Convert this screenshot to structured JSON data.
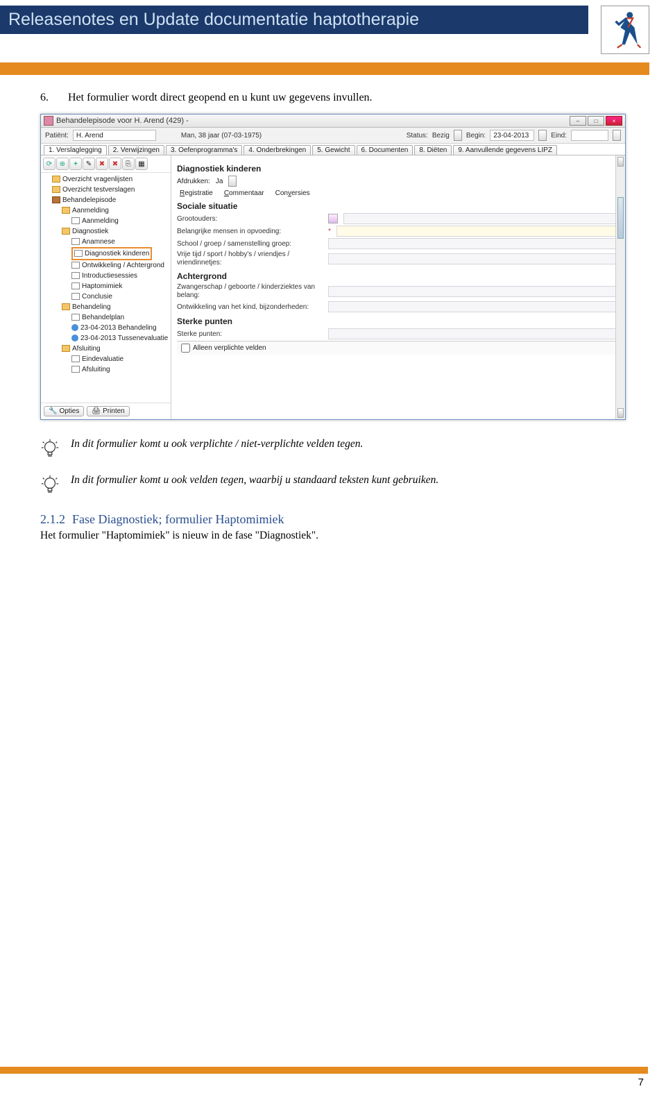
{
  "doc": {
    "title": "Releasenotes en Update documentatie haptotherapie",
    "step_num": "6.",
    "step_text": "Het formulier wordt direct geopend en u kunt uw gegevens invullen.",
    "tip1": "In dit formulier komt u ook verplichte / niet-verplichte velden tegen.",
    "tip2": "In dit formulier komt u ook velden tegen, waarbij u standaard teksten kunt gebruiken.",
    "h2_num": "2.1.2",
    "h2_text": "Fase Diagnostiek; formulier Haptomimiek",
    "h2_para": "Het formulier \"Haptomimiek\" is nieuw in de fase \"Diagnostiek\".",
    "page_number": "7"
  },
  "win": {
    "title": "Behandelepisode voor H. Arend (429) -",
    "patient_label": "Patiënt:",
    "patient_value": "H. Arend",
    "patient_info": "Man, 38 jaar (07-03-1975)",
    "status_label": "Status:",
    "status_value": "Bezig",
    "begin_label": "Begin:",
    "begin_value": "23-04-2013",
    "eind_label": "Eind:",
    "tabs": [
      "1. Verslaglegging",
      "2. Verwijzingen",
      "3. Oefenprogramma's",
      "4. Onderbrekingen",
      "5. Gewicht",
      "6. Documenten",
      "8. Diëten",
      "9. Aanvullende gegevens LIPZ"
    ],
    "tree": {
      "n1": "Overzicht vragenlijsten",
      "n2": "Overzicht testverslagen",
      "n3": "Behandelepisode",
      "n4": "Aanmelding",
      "n5": "Aanmelding",
      "n6": "Diagnostiek",
      "n7": "Anamnese",
      "n8": "Diagnostiek kinderen",
      "n9": "Ontwikkeling / Achtergrond",
      "n10": "Introductiesessies",
      "n11": "Haptomimiek",
      "n12": "Conclusie",
      "n13": "Behandeling",
      "n14": "Behandelplan",
      "n15": "23-04-2013 Behandeling",
      "n16": "23-04-2013 Tussenevaluatie",
      "n17": "Afsluiting",
      "n18": "Eindevaluatie",
      "n19": "Afsluiting"
    },
    "opties_btn": "Opties",
    "print_btn": "Printen",
    "form": {
      "header": "Diagnostiek kinderen",
      "afdrukken_label": "Afdrukken:",
      "afdrukken_value": "Ja",
      "subtabs": [
        "Registratie",
        "Commentaar",
        "Conversies"
      ],
      "sec1": "Sociale situatie",
      "f1": "Grootouders:",
      "f2": "Belangrijke mensen in opvoeding:",
      "f3": "School / groep / samenstelling groep:",
      "f4": "Vrije tijd / sport / hobby's / vriendjes / vriendinnetjes:",
      "sec2": "Achtergrond",
      "f5": "Zwangerschap / geboorte / kinderziektes van belang:",
      "f6": "Ontwikkeling van het kind, bijzonderheden:",
      "sec3": "Sterke punten",
      "f7": "Sterke punten:",
      "footer_chk": "Alleen verplichte velden"
    }
  }
}
